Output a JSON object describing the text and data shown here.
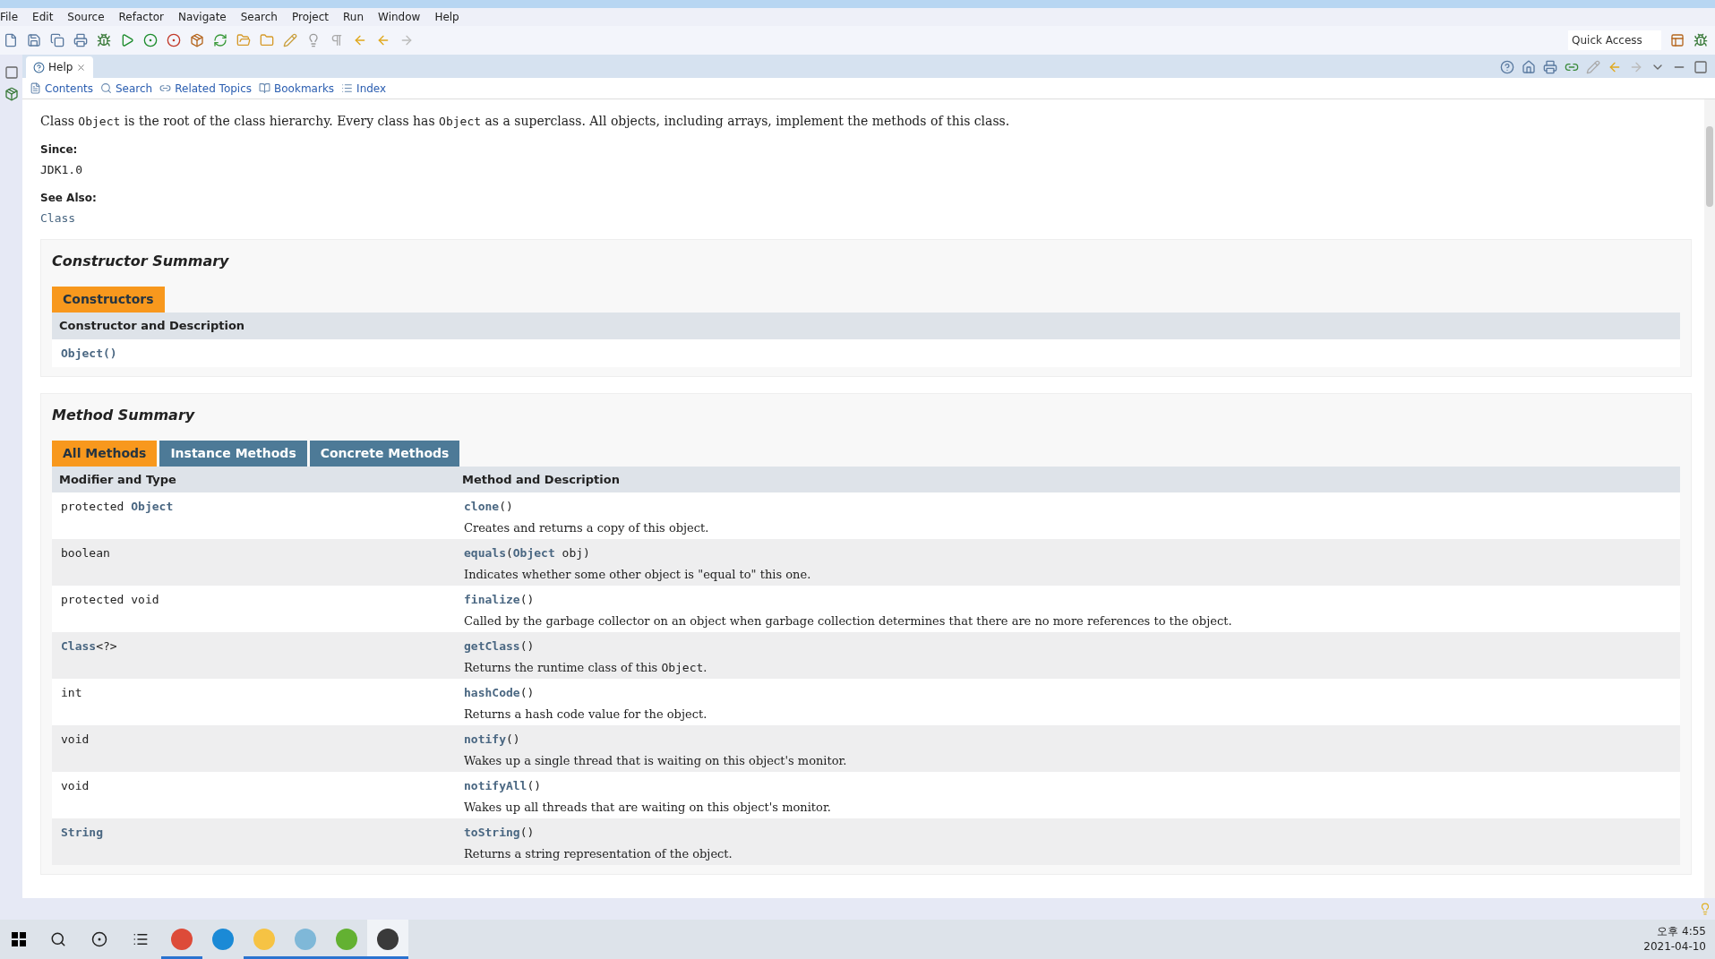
{
  "menu_bar": [
    "File",
    "Edit",
    "Source",
    "Refactor",
    "Navigate",
    "Search",
    "Project",
    "Run",
    "Window",
    "Help"
  ],
  "quick_access": {
    "placeholder": "Quick Access"
  },
  "view_tab": {
    "label": "Help",
    "selected": true
  },
  "help_toolbar": [
    "Contents",
    "Search",
    "Related Topics",
    "Bookmarks",
    "Index"
  ],
  "intro": [
    {
      "kind": "text",
      "text": "Class "
    },
    {
      "kind": "code",
      "text": "Object"
    },
    {
      "kind": "text",
      "text": " is the root of the class hierarchy. Every class has "
    },
    {
      "kind": "code",
      "text": "Object"
    },
    {
      "kind": "text",
      "text": " as a superclass. All objects, including arrays, implement the methods of this class."
    }
  ],
  "since": {
    "label": "Since:",
    "value": "JDK1.0"
  },
  "see_also": {
    "label": "See Also:",
    "value": "Class"
  },
  "constructor_summary": {
    "title": "Constructor Summary",
    "tabs": [
      {
        "label": "Constructors",
        "selected": true
      }
    ],
    "column": "Constructor and Description",
    "rows": [
      "Object()"
    ]
  },
  "method_summary": {
    "title": "Method Summary",
    "tabs": [
      {
        "label": "All Methods",
        "selected": true
      },
      {
        "label": "Instance Methods",
        "selected": false
      },
      {
        "label": "Concrete Methods",
        "selected": false
      }
    ],
    "columns": [
      "Modifier and Type",
      "Method and Description"
    ],
    "rows": [
      {
        "modifier": [
          {
            "kind": "text",
            "text": "protected "
          },
          {
            "kind": "link",
            "text": "Object"
          }
        ],
        "signature": [
          {
            "kind": "link",
            "text": "clone"
          },
          {
            "kind": "text",
            "text": "()"
          }
        ],
        "description": [
          {
            "kind": "text",
            "text": "Creates and returns a copy of this object."
          }
        ]
      },
      {
        "modifier": [
          {
            "kind": "text",
            "text": "boolean"
          }
        ],
        "signature": [
          {
            "kind": "link",
            "text": "equals"
          },
          {
            "kind": "text",
            "text": "("
          },
          {
            "kind": "link",
            "text": "Object"
          },
          {
            "kind": "text",
            "text": " obj)"
          }
        ],
        "description": [
          {
            "kind": "text",
            "text": "Indicates whether some other object is \"equal to\" this one."
          }
        ]
      },
      {
        "modifier": [
          {
            "kind": "text",
            "text": "protected void"
          }
        ],
        "signature": [
          {
            "kind": "link",
            "text": "finalize"
          },
          {
            "kind": "text",
            "text": "()"
          }
        ],
        "description": [
          {
            "kind": "text",
            "text": "Called by the garbage collector on an object when garbage collection determines that there are no more references to the object."
          }
        ]
      },
      {
        "modifier": [
          {
            "kind": "link",
            "text": "Class"
          },
          {
            "kind": "text",
            "text": "<?>"
          }
        ],
        "signature": [
          {
            "kind": "link",
            "text": "getClass"
          },
          {
            "kind": "text",
            "text": "()"
          }
        ],
        "description": [
          {
            "kind": "text",
            "text": "Returns the runtime class of this "
          },
          {
            "kind": "code",
            "text": "Object"
          },
          {
            "kind": "text",
            "text": "."
          }
        ]
      },
      {
        "modifier": [
          {
            "kind": "text",
            "text": "int"
          }
        ],
        "signature": [
          {
            "kind": "link",
            "text": "hashCode"
          },
          {
            "kind": "text",
            "text": "()"
          }
        ],
        "description": [
          {
            "kind": "text",
            "text": "Returns a hash code value for the object."
          }
        ]
      },
      {
        "modifier": [
          {
            "kind": "text",
            "text": "void"
          }
        ],
        "signature": [
          {
            "kind": "link",
            "text": "notify"
          },
          {
            "kind": "text",
            "text": "()"
          }
        ],
        "description": [
          {
            "kind": "text",
            "text": "Wakes up a single thread that is waiting on this object's monitor."
          }
        ]
      },
      {
        "modifier": [
          {
            "kind": "text",
            "text": "void"
          }
        ],
        "signature": [
          {
            "kind": "link",
            "text": "notifyAll"
          },
          {
            "kind": "text",
            "text": "()"
          }
        ],
        "description": [
          {
            "kind": "text",
            "text": "Wakes up all threads that are waiting on this object's monitor."
          }
        ]
      },
      {
        "modifier": [
          {
            "kind": "link",
            "text": "String"
          }
        ],
        "signature": [
          {
            "kind": "link",
            "text": "toString"
          },
          {
            "kind": "text",
            "text": "()"
          }
        ],
        "description": [
          {
            "kind": "text",
            "text": "Returns a string representation of the object."
          }
        ]
      }
    ]
  },
  "taskbar": {
    "apps": [
      {
        "kind": "chrome",
        "running": true,
        "selected": false
      },
      {
        "kind": "edge",
        "running": false,
        "selected": false
      },
      {
        "kind": "folder",
        "running": true,
        "selected": false
      },
      {
        "kind": "notepad",
        "running": true,
        "selected": false
      },
      {
        "kind": "torrent",
        "running": true,
        "selected": false
      },
      {
        "kind": "eclipse",
        "running": true,
        "selected": true
      }
    ],
    "time": "오후 4:55",
    "date": "2021-04-10"
  }
}
